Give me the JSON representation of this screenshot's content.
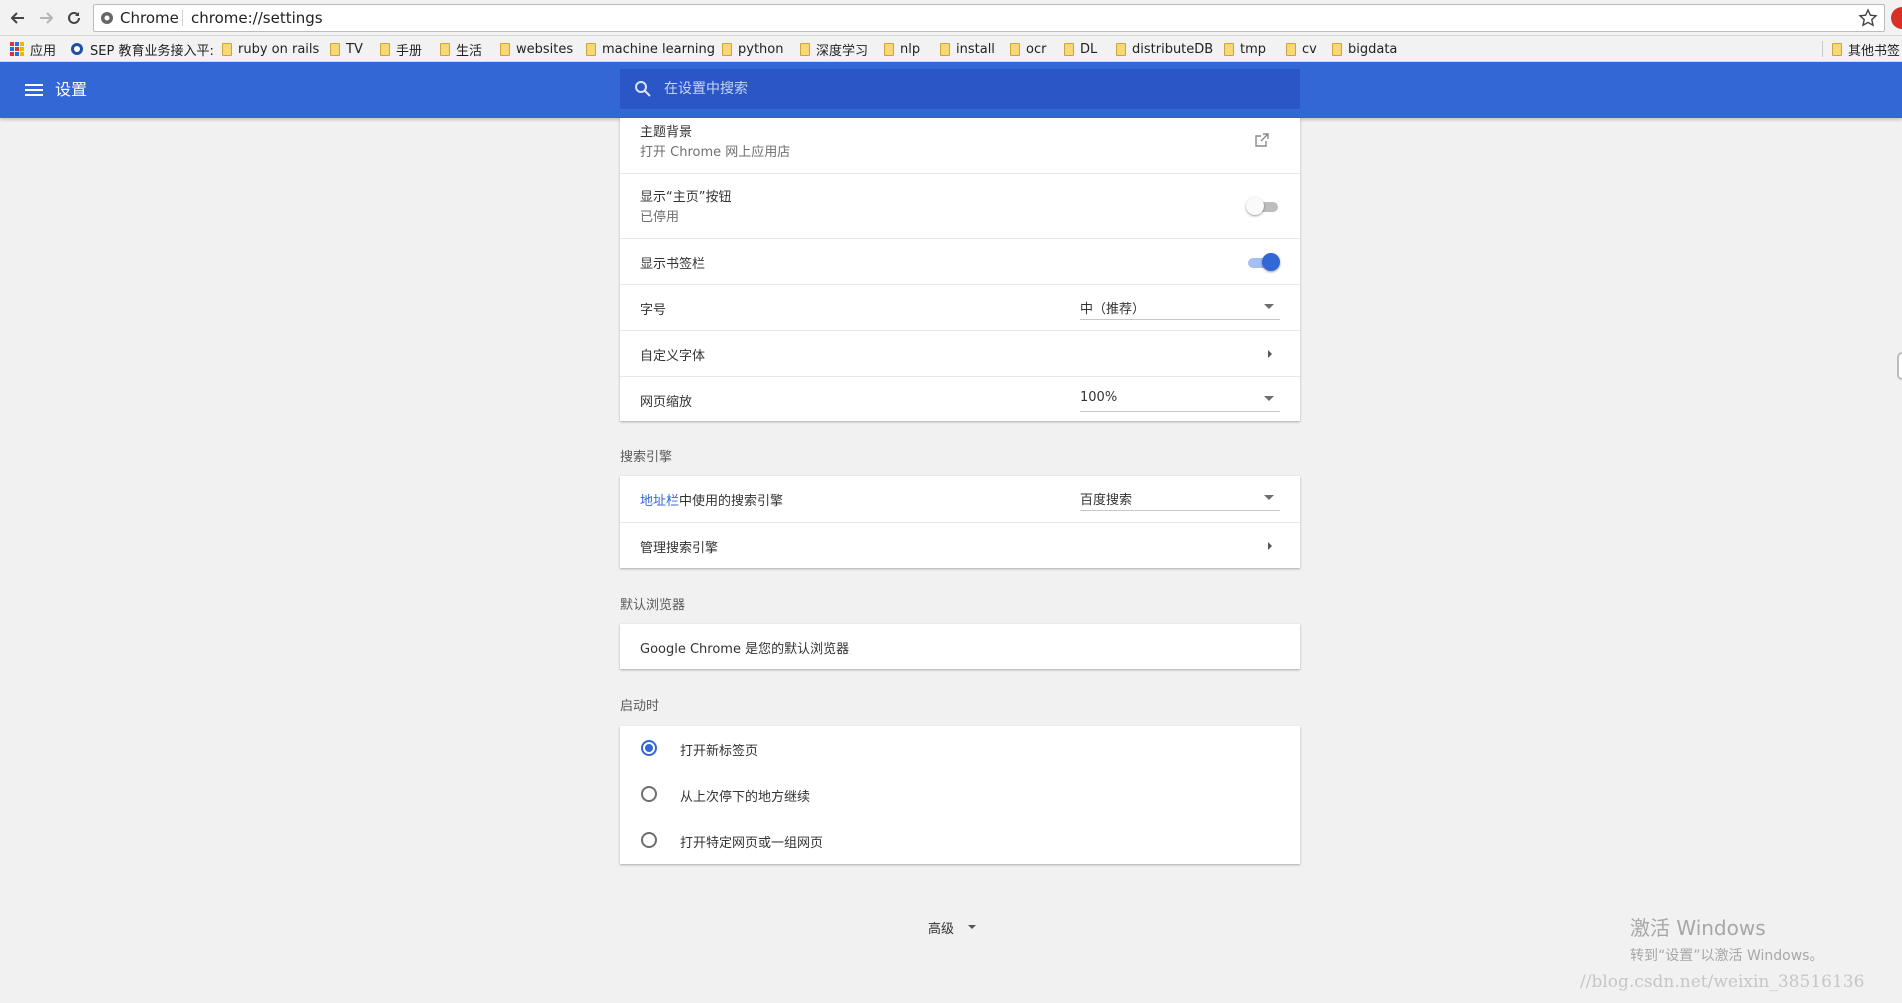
{
  "browser": {
    "site_label": "Chrome",
    "url": "chrome://settings",
    "bookmarks": [
      "应用",
      "SEP 教育业务接入平:",
      "ruby on rails",
      "TV",
      "手册",
      "生活",
      "websites",
      "machine learning",
      "python",
      "深度学习",
      "nlp",
      "install",
      "ocr",
      "DL",
      "distributeDB",
      "tmp",
      "cv",
      "bigdata",
      "其他书签"
    ]
  },
  "header": {
    "title": "设置",
    "search_placeholder": "在设置中搜索"
  },
  "appearance": {
    "theme_label": "主题背景",
    "theme_sub": "打开 Chrome 网上应用店",
    "home_button_label": "显示“主页”按钮",
    "home_button_sub": "已停用",
    "home_button_on": false,
    "bookmarks_bar_label": "显示书签栏",
    "bookmarks_bar_on": true,
    "font_size_label": "字号",
    "font_size_value": "中（推荐）",
    "custom_fonts_label": "自定义字体",
    "zoom_label": "网页缩放",
    "zoom_value": "100%"
  },
  "search_engine": {
    "section_title": "搜索引擎",
    "address_bar_link": "地址栏",
    "address_bar_rest": "中使用的搜索引擎",
    "engine_value": "百度搜索",
    "manage_label": "管理搜索引擎"
  },
  "default_browser": {
    "section_title": "默认浏览器",
    "status": "Google Chrome 是您的默认浏览器"
  },
  "startup": {
    "section_title": "启动时",
    "options": [
      {
        "label": "打开新标签页",
        "checked": true
      },
      {
        "label": "从上次停下的地方继续",
        "checked": false
      },
      {
        "label": "打开特定网页或一组网页",
        "checked": false
      }
    ]
  },
  "advanced_label": "高级",
  "watermark": {
    "line1": "激活 Windows",
    "line2": "转到“设置”以激活 Windows。",
    "csdn": "//blog.csdn.net/weixin_38516136"
  },
  "colors": {
    "header_blue": "#3367d6",
    "search_blue": "#2a56c6",
    "link_blue": "#3367d6"
  }
}
